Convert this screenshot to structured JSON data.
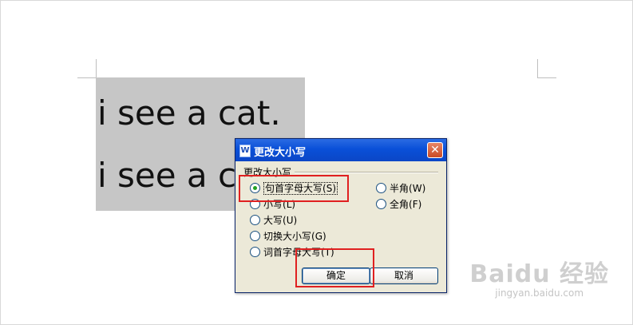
{
  "document": {
    "lines": [
      "i see a cat.",
      "i see a c"
    ]
  },
  "dialog": {
    "title": "更改大小写",
    "app_icon_glyph": "W",
    "close_glyph": "✕",
    "group_label": "更改大小写",
    "options_left": [
      {
        "label": "句首字母大写",
        "key": "(S)",
        "selected": true
      },
      {
        "label": "小写",
        "key": "(L)",
        "selected": false
      },
      {
        "label": "大写",
        "key": "(U)",
        "selected": false
      },
      {
        "label": "切换大小写",
        "key": "(G)",
        "selected": false
      },
      {
        "label": "词首字母大写",
        "key": "(T)",
        "selected": false
      }
    ],
    "options_right": [
      {
        "label": "半角",
        "key": "(W)",
        "selected": false
      },
      {
        "label": "全角",
        "key": "(F)",
        "selected": false
      }
    ],
    "ok_label": "确定",
    "cancel_label": "取消"
  },
  "watermark": {
    "brand": "Baidu 经验",
    "url": "jingyan.baidu.com"
  },
  "colors": {
    "highlight_box": "#e02020",
    "titlebar": "#0a50d8",
    "selection": "#c6c6c6"
  }
}
